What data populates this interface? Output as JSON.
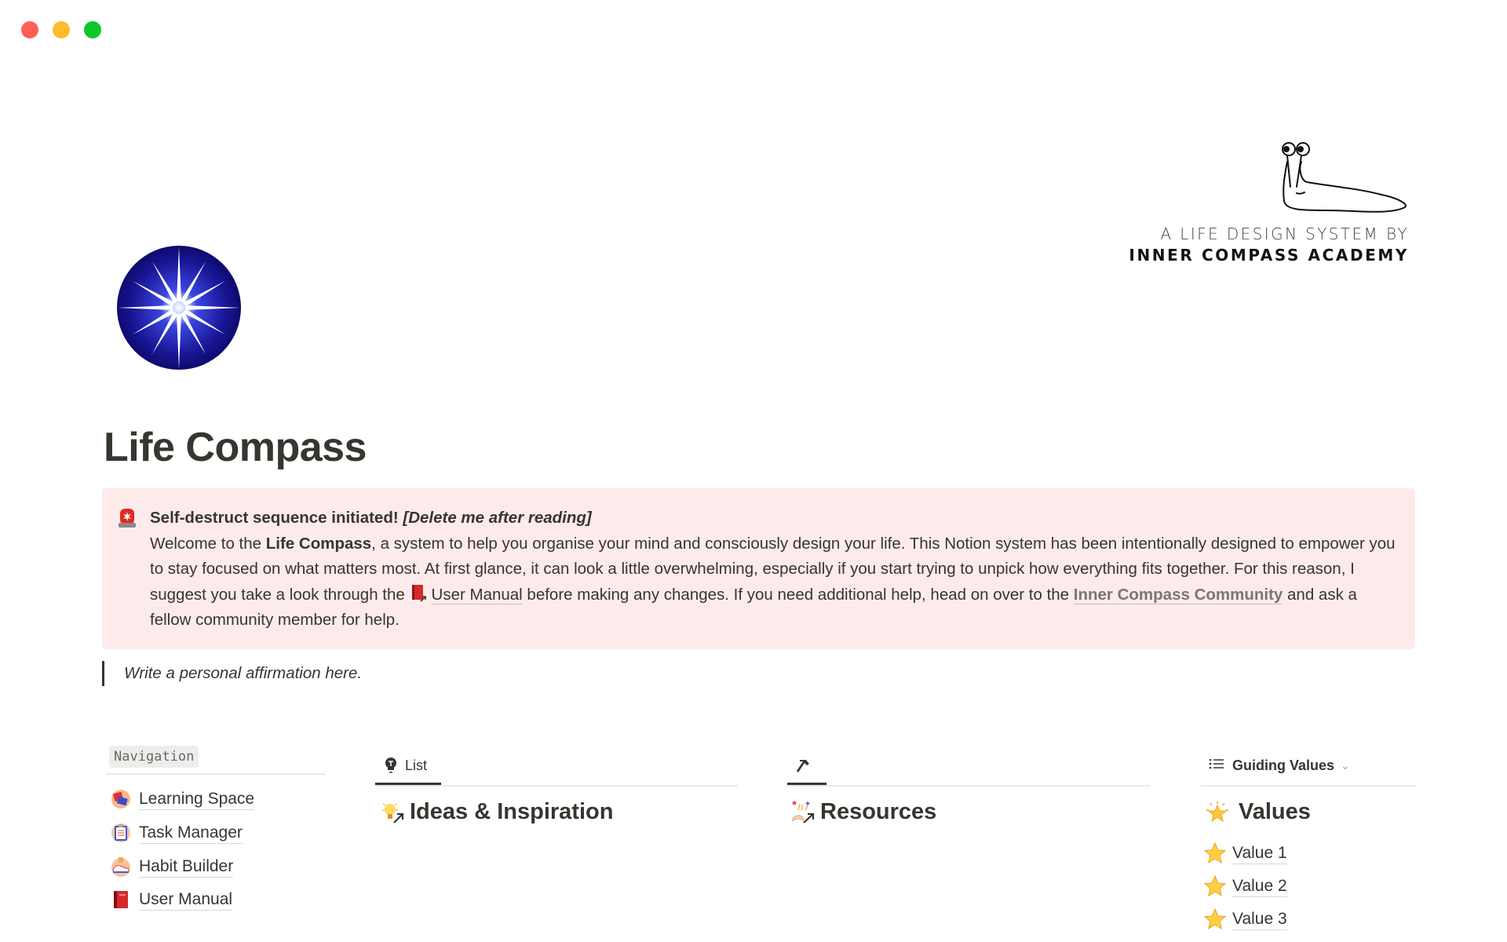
{
  "window": {
    "controls": [
      "close",
      "minimize",
      "maximize"
    ]
  },
  "logo": {
    "line1": "A LIFE DESIGN SYSTEM BY",
    "line2": "INNER COMPASS ACADEMY",
    "icon": "slug-illustration"
  },
  "page": {
    "icon": "compass-star-icon",
    "title": "Life Compass"
  },
  "callout": {
    "icon": "police-light-icon",
    "heading_bold": "Self-destruct sequence initiated! ",
    "heading_italic": "[Delete me after reading]",
    "p1_a": "Welcome to the ",
    "p1_bold": "Life Compass",
    "p1_b": ", a system to help you organise your mind and consciously design your life. This Notion system has been intentionally designed to empower you to stay focused on what matters most. At first glance, it can look a little overwhelming, especially if you start trying to unpick how everything fits together. For this reason, I suggest you take a look through the ",
    "link_user_manual": "User Manual",
    "p1_c": " before making any changes. If you need additional help, head on over to the ",
    "link_community": "Inner Compass Community",
    "p1_d": " and ask a fellow community member for help."
  },
  "quote": {
    "text": "Write a personal affirmation here."
  },
  "navigation": {
    "label": "Navigation",
    "items": [
      {
        "label": "Learning Space",
        "icon": "books-icon"
      },
      {
        "label": "Task Manager",
        "icon": "clipboard-icon"
      },
      {
        "label": "Habit Builder",
        "icon": "sneaker-icon"
      },
      {
        "label": "User Manual",
        "icon": "red-book-icon"
      }
    ]
  },
  "ideas": {
    "tab_label": "List",
    "tab_icon": "lightbulb-icon",
    "heading": "Ideas & Inspiration"
  },
  "resources": {
    "tab_icon": "hammer-icon",
    "heading": "Resources"
  },
  "values": {
    "tab_label": "Guiding Values",
    "tab_icon": "list-icon",
    "heading": "Values",
    "items": [
      {
        "label": "Value 1"
      },
      {
        "label": "Value 2"
      },
      {
        "label": "Value 3"
      }
    ]
  },
  "colors": {
    "callout_bg": "#fdebec",
    "text": "#37352f",
    "muted_link": "#787774",
    "icon_navy": "#14108a"
  }
}
